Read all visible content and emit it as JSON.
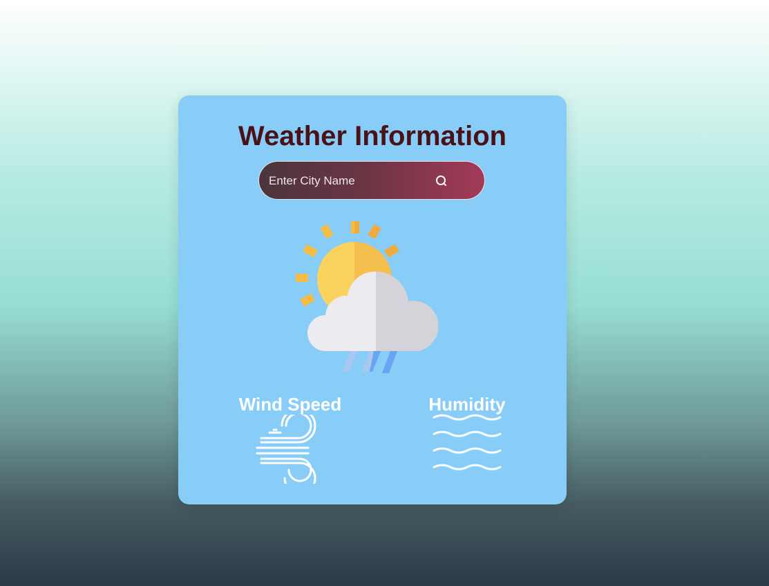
{
  "app": {
    "title": "Weather Information"
  },
  "search": {
    "placeholder": "Enter City Name",
    "value": "",
    "button_icon": "search-icon"
  },
  "weather": {
    "icon": "sun-cloud-rain-icon"
  },
  "stats": {
    "wind_label": "Wind Speed",
    "wind_icon": "wind-icon",
    "humidity_label": "Humidity",
    "humidity_icon": "humidity-waves-icon"
  },
  "colors": {
    "card": "#87cdf8",
    "title": "#4a1116",
    "search_gradient_start": "#4b353d",
    "search_gradient_end": "#a43a58"
  }
}
